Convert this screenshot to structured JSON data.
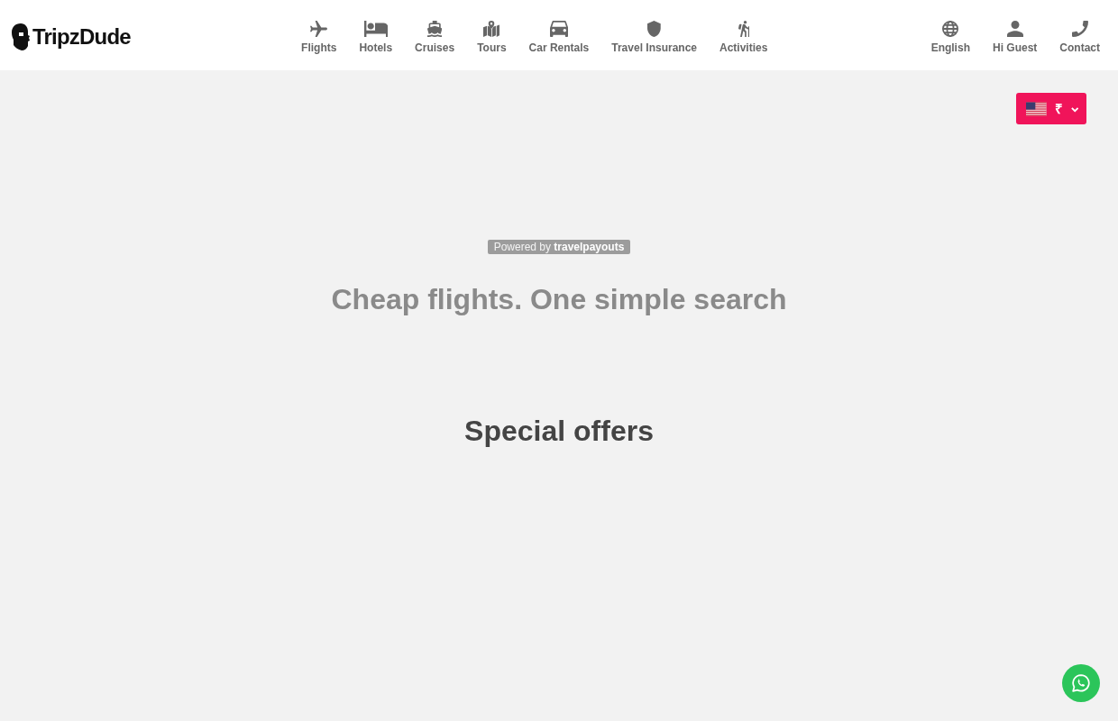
{
  "header": {
    "logo": "TripzDude",
    "nav": [
      {
        "label": "Flights"
      },
      {
        "label": "Hotels"
      },
      {
        "label": "Cruises"
      },
      {
        "label": "Tours"
      },
      {
        "label": "Car Rentals"
      },
      {
        "label": "Travel Insurance"
      },
      {
        "label": "Activities"
      }
    ],
    "user_menu": [
      {
        "label": "English"
      },
      {
        "label": "Hi Guest"
      },
      {
        "label": "Contact"
      }
    ]
  },
  "currency_selector": {
    "symbol": "₹"
  },
  "search": {
    "powered_by": "Powered by **travelpayouts**",
    "title": "Cheap flights. One simple search"
  },
  "special_offers": {
    "title": "Special offers"
  }
}
